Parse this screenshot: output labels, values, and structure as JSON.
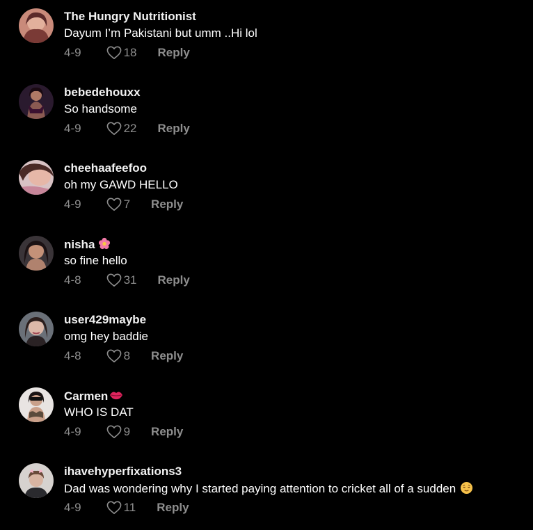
{
  "comments": [
    {
      "username": "The Hungry Nutritionist",
      "text": "Dayum I’m Pakistani but umm ..Hi lol",
      "date": "4-9",
      "likes": "18",
      "reply_label": "Reply",
      "avatar_icon": "avatar-photo"
    },
    {
      "username": "bebedehouxx",
      "text": "So handsome",
      "date": "4-9",
      "likes": "22",
      "reply_label": "Reply",
      "avatar_icon": "avatar-photo"
    },
    {
      "username": "cheehaafeefoo",
      "text": "oh my GAWD HELLO",
      "date": "4-9",
      "likes": "7",
      "reply_label": "Reply",
      "avatar_icon": "avatar-photo"
    },
    {
      "username": "nisha",
      "username_emoji": "flower-emoji",
      "text": "so fine hello",
      "date": "4-8",
      "likes": "31",
      "reply_label": "Reply",
      "avatar_icon": "avatar-photo"
    },
    {
      "username": "user429maybe",
      "text": "omg hey baddie",
      "date": "4-8",
      "likes": "8",
      "reply_label": "Reply",
      "avatar_icon": "avatar-photo"
    },
    {
      "username": "Carmen",
      "username_emoji": "lips-emoji",
      "text": "WHO IS DAT",
      "date": "4-9",
      "likes": "9",
      "reply_label": "Reply",
      "avatar_icon": "avatar-photo"
    },
    {
      "username": "ihavehyperfixations3",
      "text": "Dad was wondering why I started paying attention to cricket all of a sudden",
      "text_emoji": "relieved-face-emoji",
      "date": "4-9",
      "likes": "11",
      "reply_label": "Reply",
      "avatar_icon": "avatar-photo"
    }
  ],
  "colors": {
    "background": "#000000",
    "username": "#f2f2f2",
    "text": "#ffffff",
    "meta": "#8e8e8e"
  },
  "icons": {
    "like": "heart-outline-icon"
  }
}
